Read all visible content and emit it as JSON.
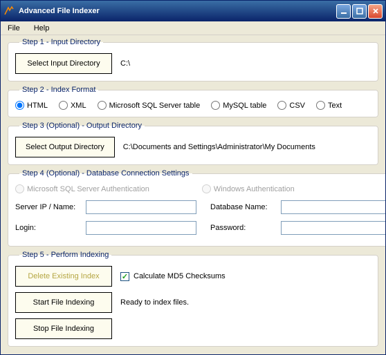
{
  "window": {
    "title": "Advanced File Indexer"
  },
  "menu": {
    "file": "File",
    "help": "Help"
  },
  "step1": {
    "legend": "Step 1 - Input Directory",
    "button": "Select Input Directory",
    "path": "C:\\"
  },
  "step2": {
    "legend": "Step 2 - Index Format",
    "options": {
      "html": "HTML",
      "xml": "XML",
      "mssql": "Microsoft SQL Server table",
      "mysql": "MySQL table",
      "csv": "CSV",
      "text": "Text"
    },
    "selected": "html"
  },
  "step3": {
    "legend": "Step 3 (Optional) - Output Directory",
    "button": "Select Output Directory",
    "path": "C:\\Documents and Settings\\Administrator\\My Documents"
  },
  "step4": {
    "legend": "Step 4 (Optional) - Database Connection Settings",
    "auth": {
      "mssql": "Microsoft SQL Server Authentication",
      "win": "Windows Authentication"
    },
    "labels": {
      "server": "Server IP / Name:",
      "login": "Login:",
      "dbname": "Database Name:",
      "password": "Password:"
    }
  },
  "step5": {
    "legend": "Step 5 - Perform Indexing",
    "delete": "Delete Existing Index",
    "md5": "Calculate MD5 Checksums",
    "start": "Start File Indexing",
    "status": "Ready to index files.",
    "stop": "Stop File Indexing"
  }
}
